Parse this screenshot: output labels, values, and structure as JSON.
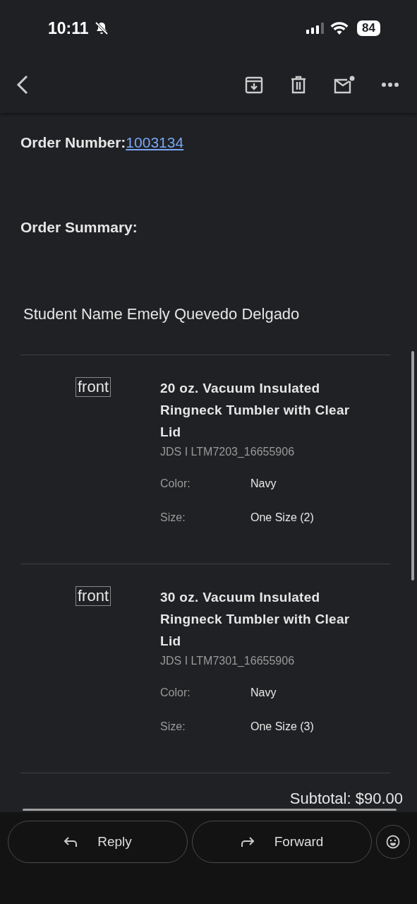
{
  "status_bar": {
    "time": "10:11",
    "battery": "84"
  },
  "order": {
    "label": "Order Number:",
    "number": "1003134"
  },
  "summary_heading": "Order Summary:",
  "student": "Student Name Emely Quevedo Delgado",
  "items": [
    {
      "image_alt": "front",
      "title": "20 oz. Vacuum Insulated Ringneck Tumbler with Clear Lid",
      "sku": "JDS I LTM7203_16655906",
      "attributes": [
        {
          "label": "Color:",
          "value": "Navy"
        },
        {
          "label": "Size:",
          "value": "One Size (2)"
        }
      ]
    },
    {
      "image_alt": "front",
      "title": "30 oz. Vacuum Insulated Ringneck Tumbler with Clear Lid",
      "sku": "JDS I LTM7301_16655906",
      "attributes": [
        {
          "label": "Color:",
          "value": "Navy"
        },
        {
          "label": "Size:",
          "value": "One Size (3)"
        }
      ]
    }
  ],
  "subtotal": "Subtotal: $90.00",
  "actions": [
    {
      "kind": "reply",
      "label": "Reply"
    },
    {
      "kind": "forward",
      "label": "Forward"
    }
  ]
}
